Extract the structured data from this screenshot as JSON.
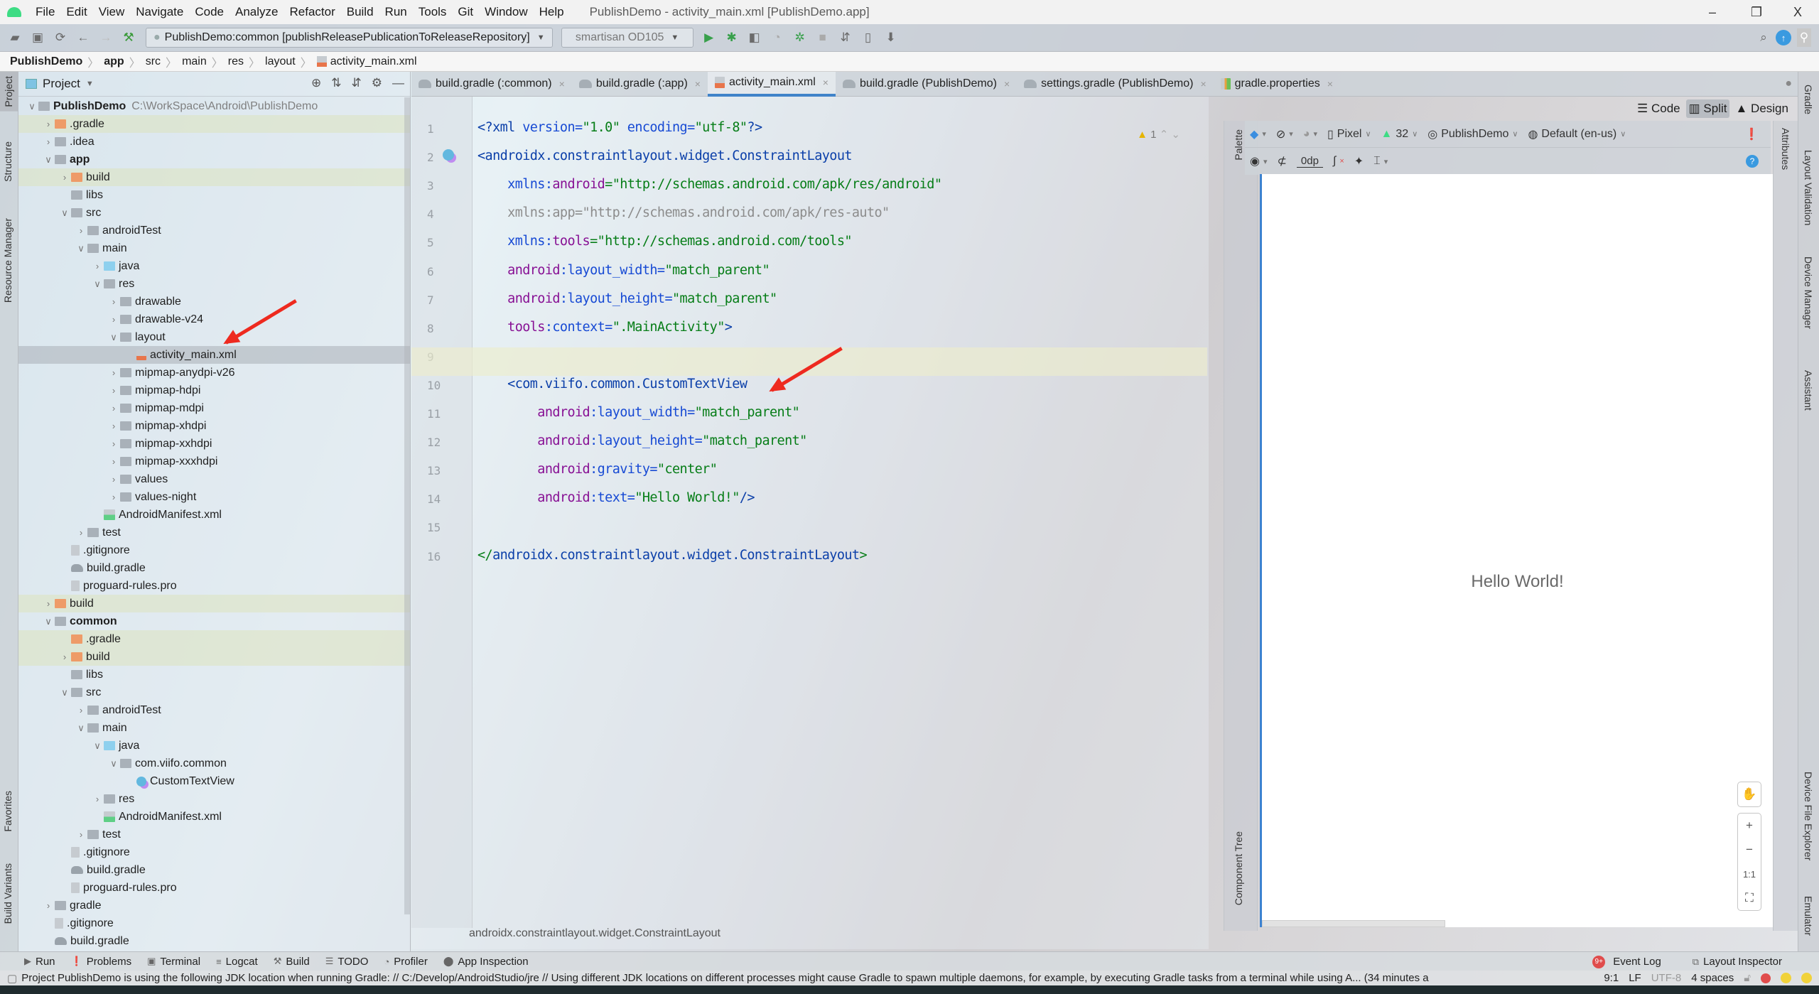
{
  "window": {
    "title": "PublishDemo - activity_main.xml [PublishDemo.app]",
    "controls": {
      "minimize": "–",
      "restore": "❐",
      "close": "X"
    }
  },
  "menu": [
    "File",
    "Edit",
    "View",
    "Navigate",
    "Code",
    "Analyze",
    "Refactor",
    "Build",
    "Run",
    "Tools",
    "Git",
    "Window",
    "Help"
  ],
  "toolbar": {
    "run_config": "PublishDemo:common [publishReleasePublicationToReleaseRepository]",
    "device": "smartisan OD105"
  },
  "breadcrumb": [
    "PublishDemo",
    "app",
    "src",
    "main",
    "res",
    "layout",
    "activity_main.xml"
  ],
  "left_strip": [
    "Project",
    "Structure",
    "Resource Manager",
    "Favorites",
    "Build Variants"
  ],
  "project_panel": {
    "title": "Project",
    "tree": [
      {
        "label": "PublishDemo",
        "path": "C:\\WorkSpace\\Android\\PublishDemo",
        "depth": 0,
        "expanded": true,
        "icon": "module",
        "bold": true
      },
      {
        "label": ".gradle",
        "depth": 1,
        "expanded": false,
        "icon": "folder-orange",
        "hl": true
      },
      {
        "label": ".idea",
        "depth": 1,
        "expanded": false,
        "icon": "folder"
      },
      {
        "label": "app",
        "depth": 1,
        "expanded": true,
        "icon": "module",
        "bold": true
      },
      {
        "label": "build",
        "depth": 2,
        "expanded": false,
        "icon": "folder-orange",
        "hl": true
      },
      {
        "label": "libs",
        "depth": 2,
        "icon": "folder"
      },
      {
        "label": "src",
        "depth": 2,
        "expanded": true,
        "icon": "folder"
      },
      {
        "label": "androidTest",
        "depth": 3,
        "expanded": false,
        "icon": "folder"
      },
      {
        "label": "main",
        "depth": 3,
        "expanded": true,
        "icon": "folder"
      },
      {
        "label": "java",
        "depth": 4,
        "expanded": false,
        "icon": "folder-blue"
      },
      {
        "label": "res",
        "depth": 4,
        "expanded": true,
        "icon": "folder"
      },
      {
        "label": "drawable",
        "depth": 5,
        "expanded": false,
        "icon": "folder"
      },
      {
        "label": "drawable-v24",
        "depth": 5,
        "expanded": false,
        "icon": "folder"
      },
      {
        "label": "layout",
        "depth": 5,
        "expanded": true,
        "icon": "folder"
      },
      {
        "label": "activity_main.xml",
        "depth": 6,
        "icon": "xml",
        "selected": true
      },
      {
        "label": "mipmap-anydpi-v26",
        "depth": 5,
        "expanded": false,
        "icon": "folder"
      },
      {
        "label": "mipmap-hdpi",
        "depth": 5,
        "expanded": false,
        "icon": "folder"
      },
      {
        "label": "mipmap-mdpi",
        "depth": 5,
        "expanded": false,
        "icon": "folder"
      },
      {
        "label": "mipmap-xhdpi",
        "depth": 5,
        "expanded": false,
        "icon": "folder"
      },
      {
        "label": "mipmap-xxhdpi",
        "depth": 5,
        "expanded": false,
        "icon": "folder"
      },
      {
        "label": "mipmap-xxxhdpi",
        "depth": 5,
        "expanded": false,
        "icon": "folder"
      },
      {
        "label": "values",
        "depth": 5,
        "expanded": false,
        "icon": "folder"
      },
      {
        "label": "values-night",
        "depth": 5,
        "expanded": false,
        "icon": "folder"
      },
      {
        "label": "AndroidManifest.xml",
        "depth": 4,
        "icon": "manifest"
      },
      {
        "label": "test",
        "depth": 3,
        "expanded": false,
        "icon": "folder"
      },
      {
        "label": ".gitignore",
        "depth": 2,
        "icon": "file"
      },
      {
        "label": "build.gradle",
        "depth": 2,
        "icon": "gradle"
      },
      {
        "label": "proguard-rules.pro",
        "depth": 2,
        "icon": "file"
      },
      {
        "label": "build",
        "depth": 1,
        "expanded": false,
        "icon": "folder-orange",
        "hl": true
      },
      {
        "label": "common",
        "depth": 1,
        "expanded": true,
        "icon": "module",
        "bold": true
      },
      {
        "label": ".gradle",
        "depth": 2,
        "icon": "folder-orange",
        "hl": true
      },
      {
        "label": "build",
        "depth": 2,
        "expanded": false,
        "icon": "folder-orange",
        "hl": true
      },
      {
        "label": "libs",
        "depth": 2,
        "icon": "folder"
      },
      {
        "label": "src",
        "depth": 2,
        "expanded": true,
        "icon": "folder"
      },
      {
        "label": "androidTest",
        "depth": 3,
        "expanded": false,
        "icon": "folder"
      },
      {
        "label": "main",
        "depth": 3,
        "expanded": true,
        "icon": "folder"
      },
      {
        "label": "java",
        "depth": 4,
        "expanded": true,
        "icon": "folder-blue"
      },
      {
        "label": "com.viifo.common",
        "depth": 5,
        "expanded": true,
        "icon": "folder"
      },
      {
        "label": "CustomTextView",
        "depth": 6,
        "icon": "class"
      },
      {
        "label": "res",
        "depth": 4,
        "expanded": false,
        "icon": "folder"
      },
      {
        "label": "AndroidManifest.xml",
        "depth": 4,
        "icon": "manifest"
      },
      {
        "label": "test",
        "depth": 3,
        "expanded": false,
        "icon": "folder"
      },
      {
        "label": ".gitignore",
        "depth": 2,
        "icon": "file"
      },
      {
        "label": "build.gradle",
        "depth": 2,
        "icon": "gradle"
      },
      {
        "label": "proguard-rules.pro",
        "depth": 2,
        "icon": "file"
      },
      {
        "label": "gradle",
        "depth": 1,
        "expanded": false,
        "icon": "folder"
      },
      {
        "label": ".gitignore",
        "depth": 1,
        "icon": "file"
      },
      {
        "label": "build.gradle",
        "depth": 1,
        "icon": "gradle"
      }
    ]
  },
  "editor_tabs": [
    {
      "label": "build.gradle (:common)",
      "icon": "gradle"
    },
    {
      "label": "build.gradle (:app)",
      "icon": "gradle"
    },
    {
      "label": "activity_main.xml",
      "icon": "xml",
      "active": true
    },
    {
      "label": "build.gradle (PublishDemo)",
      "icon": "gradle"
    },
    {
      "label": "settings.gradle (PublishDemo)",
      "icon": "gradle"
    },
    {
      "label": "gradle.properties",
      "icon": "properties"
    }
  ],
  "editor": {
    "warnings": "1",
    "current_line": 9,
    "lines": [
      [
        [
          "t-pi",
          "<?xml "
        ],
        [
          "t-attr",
          "version="
        ],
        [
          "t-val",
          "\"1.0\" "
        ],
        [
          "t-attr",
          "encoding="
        ],
        [
          "t-val",
          "\"utf-8\""
        ],
        [
          "t-pi",
          "?>"
        ]
      ],
      [
        [
          "t-tag",
          "<androidx.constraintlayout.widget.ConstraintLayout"
        ]
      ],
      [
        [
          "t-attr",
          "    xmlns:"
        ],
        [
          "t-ns",
          "android"
        ],
        [
          "t-val",
          "=\"http://schemas.android.com/apk/res/android\""
        ]
      ],
      [
        [
          "t-dim",
          "    xmlns:app=\"http://schemas.android.com/apk/res-auto\""
        ]
      ],
      [
        [
          "t-attr",
          "    xmlns:"
        ],
        [
          "t-ns",
          "tools"
        ],
        [
          "t-val",
          "=\"http://schemas.android.com/tools\""
        ]
      ],
      [
        [
          "t-ns",
          "    android"
        ],
        [
          "t-attr",
          ":layout_width="
        ],
        [
          "t-val",
          "\"match_parent\""
        ]
      ],
      [
        [
          "t-ns",
          "    android"
        ],
        [
          "t-attr",
          ":layout_height="
        ],
        [
          "t-val",
          "\"match_parent\""
        ]
      ],
      [
        [
          "t-ns",
          "    tools"
        ],
        [
          "t-attr",
          ":context="
        ],
        [
          "t-val",
          "\".MainActivity\""
        ],
        [
          "t-tag",
          ">"
        ]
      ],
      [
        [
          "t-dim",
          ""
        ]
      ],
      [
        [
          "t-tag",
          "    <com.viifo.common.CustomTextView"
        ]
      ],
      [
        [
          "t-ns",
          "        android"
        ],
        [
          "t-attr",
          ":layout_width="
        ],
        [
          "t-val",
          "\"match_parent\""
        ]
      ],
      [
        [
          "t-ns",
          "        android"
        ],
        [
          "t-attr",
          ":layout_height="
        ],
        [
          "t-val",
          "\"match_parent\""
        ]
      ],
      [
        [
          "t-ns",
          "        android"
        ],
        [
          "t-attr",
          ":gravity="
        ],
        [
          "t-val",
          "\"center\""
        ]
      ],
      [
        [
          "t-ns",
          "        android"
        ],
        [
          "t-attr",
          ":text="
        ],
        [
          "t-val",
          "\"Hello World!\""
        ],
        [
          "t-tag",
          "/>"
        ]
      ],
      [
        [
          "t-dim",
          ""
        ]
      ],
      [
        [
          "t-br",
          "</"
        ],
        [
          "t-tag",
          "androidx.constraintlayout.widget.ConstraintLayout"
        ],
        [
          "t-br",
          ">"
        ]
      ]
    ],
    "footer_path": "androidx.constraintlayout.widget.ConstraintLayout"
  },
  "view_modes": {
    "code": "Code",
    "split": "Split",
    "design": "Design",
    "active": "Split"
  },
  "design_toolbar": {
    "device": "Pixel",
    "api": "32",
    "theme": "PublishDemo",
    "locale": "Default (en-us)",
    "margin": "0dp"
  },
  "side_panels": {
    "palette": "Palette",
    "component_tree": "Component Tree",
    "attributes": "Attributes"
  },
  "preview": {
    "text": "Hello World!",
    "zoom_controls": [
      "✋",
      "+",
      "−",
      "1:1",
      "⛶"
    ]
  },
  "right_strip": [
    "Gradle",
    "Layout Validation",
    "Device Manager",
    "Assistant",
    "Device File Explorer",
    "Emulator"
  ],
  "bottom_tools": [
    {
      "label": "Run",
      "icon": "▶"
    },
    {
      "label": "Problems",
      "icon": "❗"
    },
    {
      "label": "Terminal",
      "icon": "▣"
    },
    {
      "label": "Logcat",
      "icon": "≡"
    },
    {
      "label": "Build",
      "icon": "⚒"
    },
    {
      "label": "TODO",
      "icon": "☰"
    },
    {
      "label": "Profiler",
      "icon": "◔"
    },
    {
      "label": "App Inspection",
      "icon": "⬤"
    }
  ],
  "bottom_right": {
    "event_log": "Event Log",
    "event_badge": "9+",
    "layout_inspector": "Layout Inspector"
  },
  "status": {
    "message": "Project PublishDemo is using the following JDK location when running Gradle: // C:/Develop/AndroidStudio/jre // Using different JDK locations on different processes might cause Gradle to spawn multiple daemons, for example, by executing Gradle tasks from a terminal while using A... (34 minutes a",
    "position": "9:1",
    "line_sep": "LF",
    "encoding": "UTF-8",
    "indent": "4 spaces"
  }
}
